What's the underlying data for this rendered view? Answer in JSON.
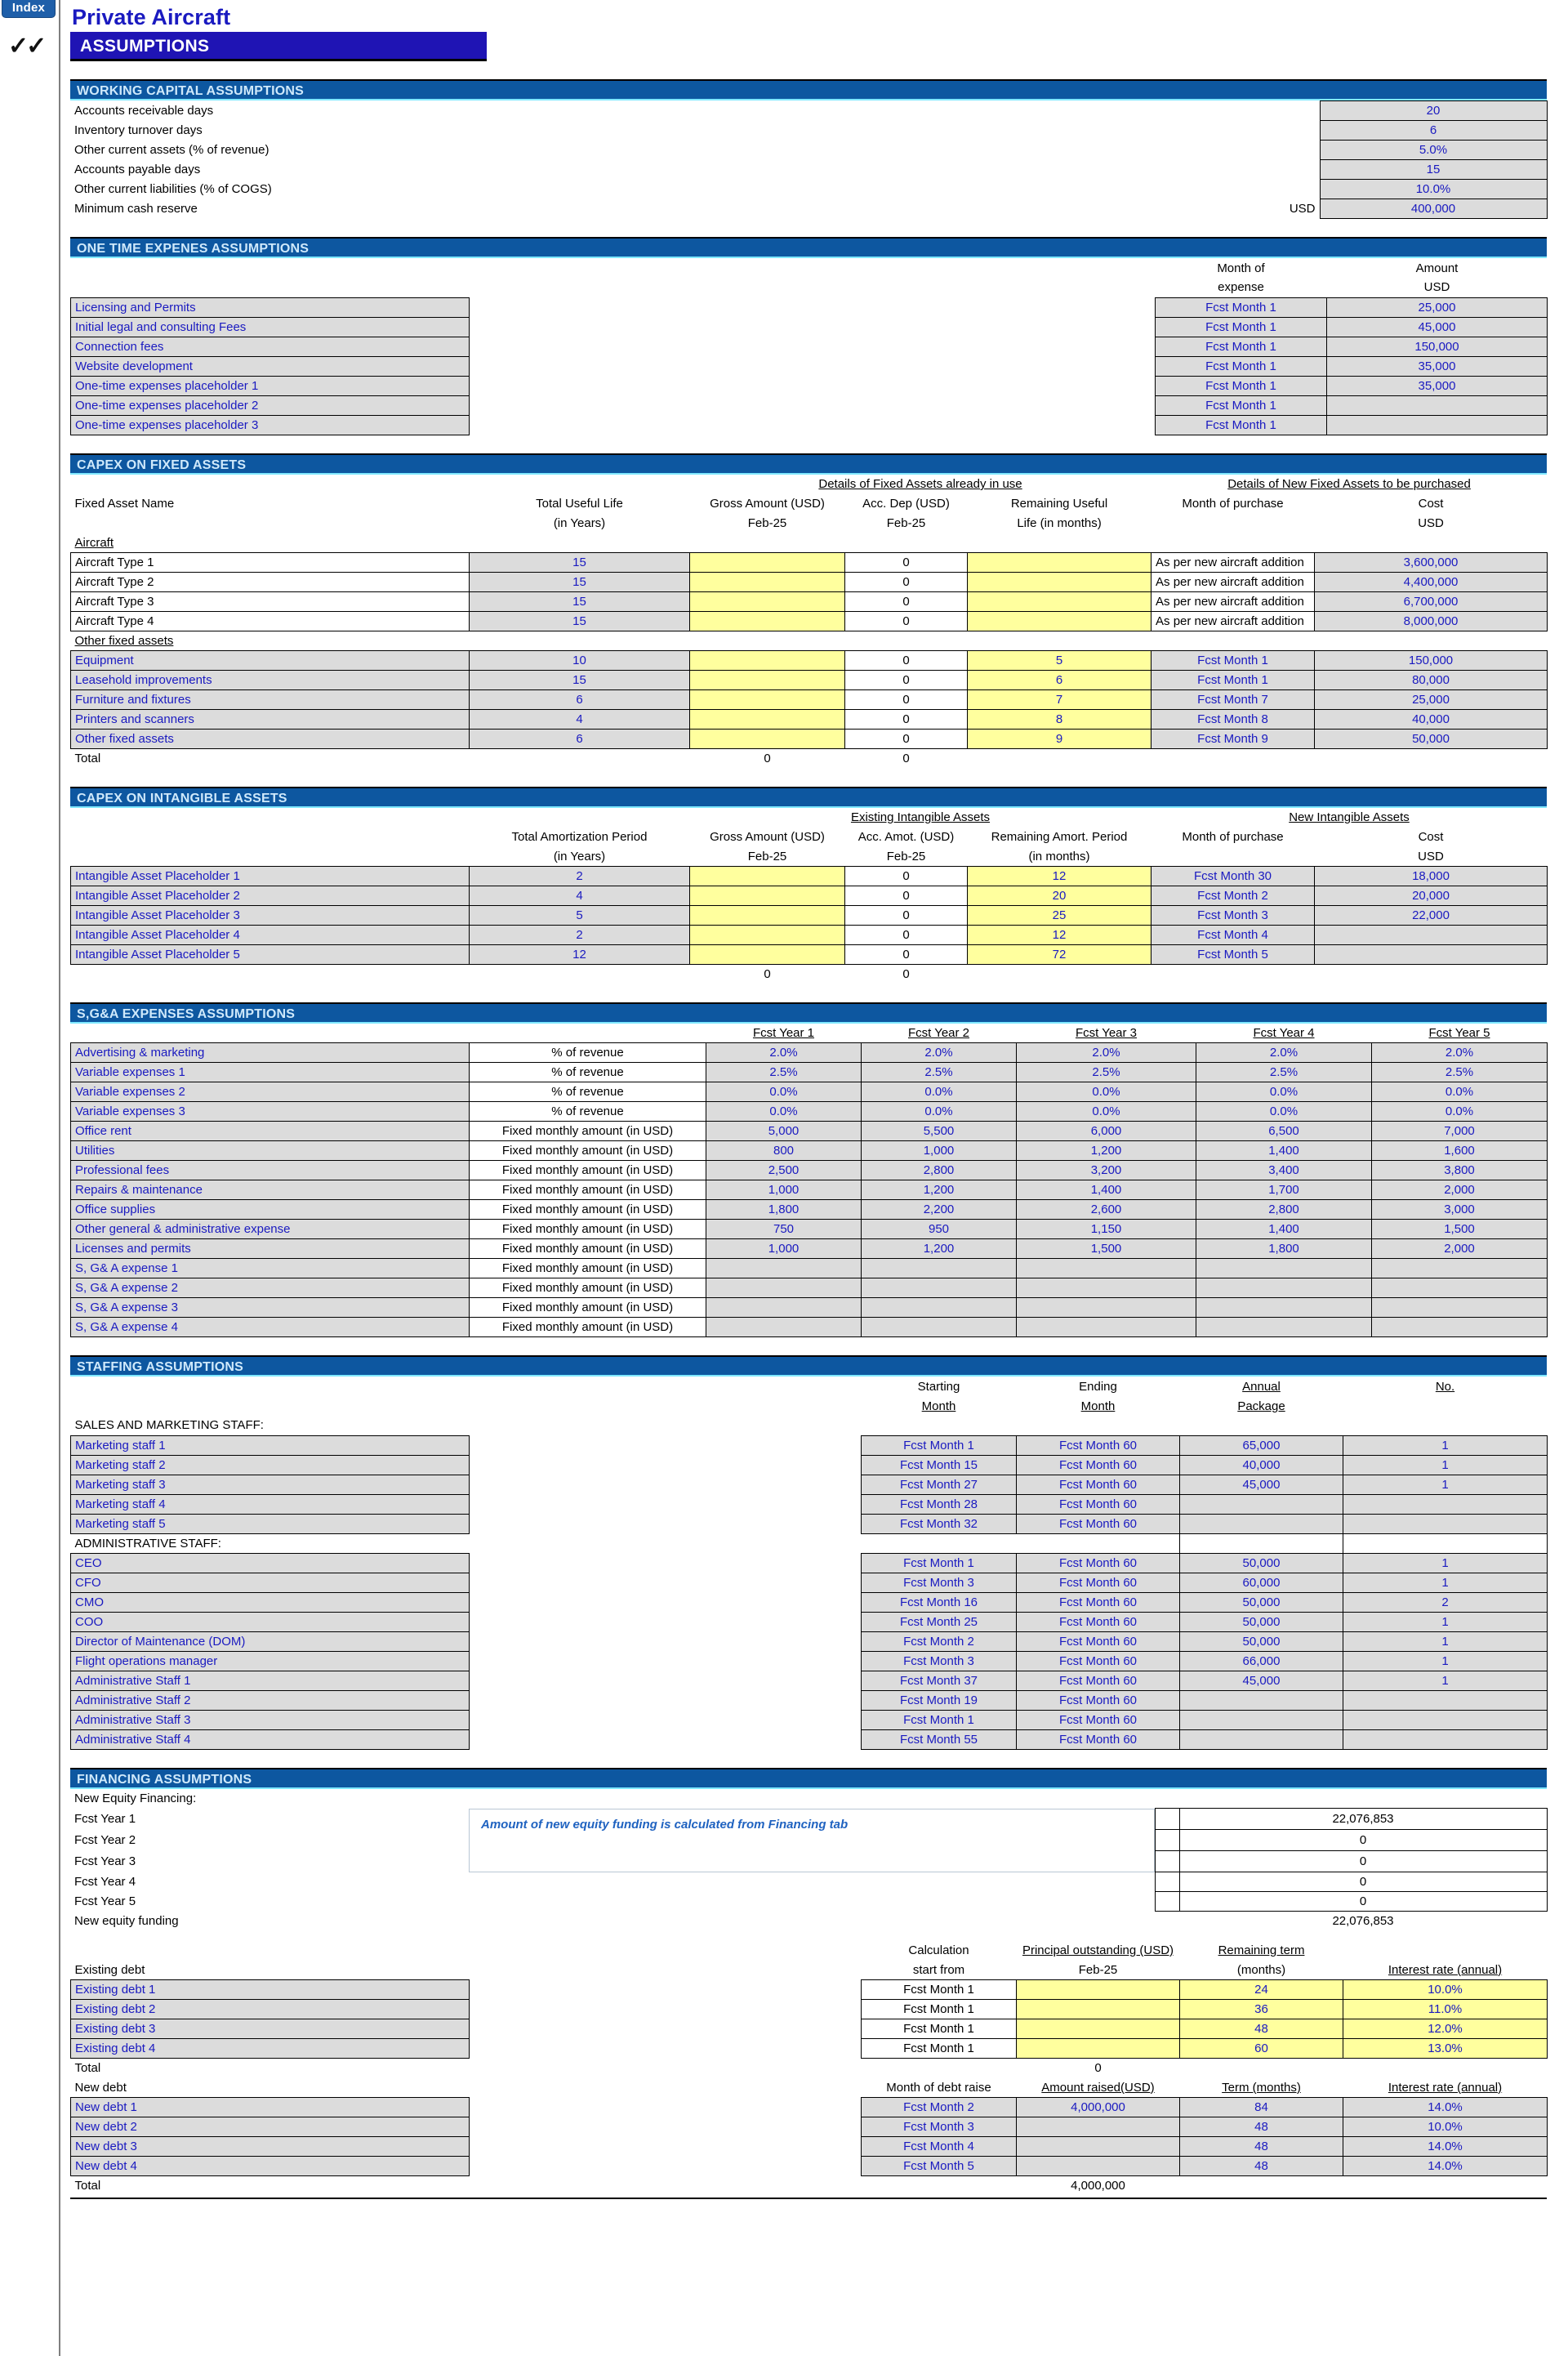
{
  "app": {
    "index_button": "Index",
    "checkmarks": "✓✓",
    "doc_title": "Private Aircraft",
    "page_title": "ASSUMPTIONS"
  },
  "working_capital": {
    "heading": "WORKING CAPITAL ASSUMPTIONS",
    "currency_label": "USD",
    "rows": [
      {
        "label": "Accounts receivable days",
        "value": "20"
      },
      {
        "label": "Inventory turnover days",
        "value": "6"
      },
      {
        "label": "Other current assets (% of revenue)",
        "value": "5.0%"
      },
      {
        "label": "Accounts payable days",
        "value": "15"
      },
      {
        "label": "Other current liabilities (% of COGS)",
        "value": "10.0%"
      },
      {
        "label": "Minimum cash reserve",
        "value": "400,000"
      }
    ]
  },
  "one_time_expenses": {
    "heading": "ONE TIME EXPENES ASSUMPTIONS",
    "col_month_1": "Month of",
    "col_month_2": "expense",
    "col_amount_1": "Amount",
    "col_amount_2": "USD",
    "rows": [
      {
        "label": "Licensing and Permits",
        "month": "Fcst Month 1",
        "amount": "25,000"
      },
      {
        "label": "Initial legal and consulting Fees",
        "month": "Fcst Month 1",
        "amount": "45,000"
      },
      {
        "label": "Connection fees",
        "month": "Fcst Month 1",
        "amount": "150,000"
      },
      {
        "label": "Website development",
        "month": "Fcst Month 1",
        "amount": "35,000"
      },
      {
        "label": "One-time expenses placeholder 1",
        "month": "Fcst Month 1",
        "amount": "35,000"
      },
      {
        "label": "One-time expenses placeholder 2",
        "month": "Fcst Month 1",
        "amount": ""
      },
      {
        "label": "One-time expenses placeholder 3",
        "month": "Fcst Month 1",
        "amount": ""
      }
    ]
  },
  "capex_fixed": {
    "heading": "CAPEX ON FIXED ASSETS",
    "group_existing": "Details of Fixed Assets already in use",
    "group_new": "Details of New Fixed Assets to be purchased",
    "col_name": "Fixed Asset Name",
    "col_life_1": "Total Useful Life",
    "col_life_2": "(in Years)",
    "col_gross_1": "Gross Amount (USD)",
    "col_gross_2": "Feb-25",
    "col_accdep_1": "Acc. Dep (USD)",
    "col_accdep_2": "Feb-25",
    "col_remaining_1": "Remaining Useful",
    "col_remaining_2": "Life (in months)",
    "col_month": "Month of purchase",
    "col_cost_1": "Cost",
    "col_cost_2": "USD",
    "group_aircraft": "Aircraft",
    "group_other": "Other fixed assets",
    "total_label": "Total",
    "total_gross": "0",
    "total_accdep": "0",
    "aircraft": [
      {
        "name": "Aircraft Type 1",
        "life": "15",
        "gross": "",
        "accdep": "0",
        "remaining": "",
        "month": "As per new aircraft addition",
        "cost": "3,600,000"
      },
      {
        "name": "Aircraft Type 2",
        "life": "15",
        "gross": "",
        "accdep": "0",
        "remaining": "",
        "month": "As per new aircraft addition",
        "cost": "4,400,000"
      },
      {
        "name": "Aircraft Type 3",
        "life": "15",
        "gross": "",
        "accdep": "0",
        "remaining": "",
        "month": "As per new aircraft addition",
        "cost": "6,700,000"
      },
      {
        "name": "Aircraft Type 4",
        "life": "15",
        "gross": "",
        "accdep": "0",
        "remaining": "",
        "month": "As per new aircraft addition",
        "cost": "8,000,000"
      }
    ],
    "other": [
      {
        "name": "Equipment",
        "life": "10",
        "gross": "",
        "accdep": "0",
        "remaining": "5",
        "month": "Fcst Month 1",
        "cost": "150,000"
      },
      {
        "name": "Leasehold improvements",
        "life": "15",
        "gross": "",
        "accdep": "0",
        "remaining": "6",
        "month": "Fcst Month 1",
        "cost": "80,000"
      },
      {
        "name": "Furniture and fixtures",
        "life": "6",
        "gross": "",
        "accdep": "0",
        "remaining": "7",
        "month": "Fcst Month 7",
        "cost": "25,000"
      },
      {
        "name": "Printers and scanners",
        "life": "4",
        "gross": "",
        "accdep": "0",
        "remaining": "8",
        "month": "Fcst Month 8",
        "cost": "40,000"
      },
      {
        "name": "Other fixed assets",
        "life": "6",
        "gross": "",
        "accdep": "0",
        "remaining": "9",
        "month": "Fcst Month 9",
        "cost": "50,000"
      }
    ]
  },
  "capex_intangible": {
    "heading": "CAPEX ON INTANGIBLE ASSETS",
    "group_existing": "Existing Intangible Assets",
    "group_new": "New Intangible Assets",
    "col_period_1": "Total Amortization Period",
    "col_period_2": "(in Years)",
    "col_gross_1": "Gross Amount (USD)",
    "col_gross_2": "Feb-25",
    "col_accamot_1": "Acc. Amot. (USD)",
    "col_accamot_2": "Feb-25",
    "col_remaining_1": "Remaining Amort. Period",
    "col_remaining_2": "(in months)",
    "col_month": "Month of purchase",
    "col_cost_1": "Cost",
    "col_cost_2": "USD",
    "total_gross": "0",
    "total_accamot": "0",
    "rows": [
      {
        "name": "Intangible Asset Placeholder 1",
        "period": "2",
        "gross": "",
        "accamot": "0",
        "remaining": "12",
        "month": "Fcst Month 30",
        "cost": "18,000"
      },
      {
        "name": "Intangible Asset Placeholder 2",
        "period": "4",
        "gross": "",
        "accamot": "0",
        "remaining": "20",
        "month": "Fcst Month 2",
        "cost": "20,000"
      },
      {
        "name": "Intangible Asset Placeholder 3",
        "period": "5",
        "gross": "",
        "accamot": "0",
        "remaining": "25",
        "month": "Fcst Month 3",
        "cost": "22,000"
      },
      {
        "name": "Intangible Asset Placeholder 4",
        "period": "2",
        "gross": "",
        "accamot": "0",
        "remaining": "12",
        "month": "Fcst Month 4",
        "cost": ""
      },
      {
        "name": "Intangible Asset Placeholder 5",
        "period": "12",
        "gross": "",
        "accamot": "0",
        "remaining": "72",
        "month": "Fcst Month 5",
        "cost": ""
      }
    ]
  },
  "sga": {
    "heading": "S,G&A EXPENSES ASSUMPTIONS",
    "year_headers": [
      "Fcst Year 1",
      "Fcst Year 2",
      "Fcst Year 3",
      "Fcst Year 4",
      "Fcst Year 5"
    ],
    "basis_pct": "% of revenue",
    "basis_fixed": "Fixed monthly amount (in USD)",
    "rows": [
      {
        "label": "Advertising & marketing",
        "basis": "% of revenue",
        "values": [
          "2.0%",
          "2.0%",
          "2.0%",
          "2.0%",
          "2.0%"
        ]
      },
      {
        "label": "Variable expenses 1",
        "basis": "% of revenue",
        "values": [
          "2.5%",
          "2.5%",
          "2.5%",
          "2.5%",
          "2.5%"
        ]
      },
      {
        "label": "Variable expenses 2",
        "basis": "% of revenue",
        "values": [
          "0.0%",
          "0.0%",
          "0.0%",
          "0.0%",
          "0.0%"
        ]
      },
      {
        "label": "Variable expenses 3",
        "basis": "% of revenue",
        "values": [
          "0.0%",
          "0.0%",
          "0.0%",
          "0.0%",
          "0.0%"
        ]
      },
      {
        "label": "Office rent",
        "basis": "Fixed monthly amount (in USD)",
        "values": [
          "5,000",
          "5,500",
          "6,000",
          "6,500",
          "7,000"
        ]
      },
      {
        "label": "Utilities",
        "basis": "Fixed monthly amount (in USD)",
        "values": [
          "800",
          "1,000",
          "1,200",
          "1,400",
          "1,600"
        ]
      },
      {
        "label": "Professional fees",
        "basis": "Fixed monthly amount (in USD)",
        "values": [
          "2,500",
          "2,800",
          "3,200",
          "3,400",
          "3,800"
        ]
      },
      {
        "label": "Repairs & maintenance",
        "basis": "Fixed monthly amount (in USD)",
        "values": [
          "1,000",
          "1,200",
          "1,400",
          "1,700",
          "2,000"
        ]
      },
      {
        "label": "Office supplies",
        "basis": "Fixed monthly amount (in USD)",
        "values": [
          "1,800",
          "2,200",
          "2,600",
          "2,800",
          "3,000"
        ]
      },
      {
        "label": "Other general & administrative expense",
        "basis": "Fixed monthly amount (in USD)",
        "values": [
          "750",
          "950",
          "1,150",
          "1,400",
          "1,500"
        ]
      },
      {
        "label": "Licenses and permits",
        "basis": "Fixed monthly amount (in USD)",
        "values": [
          "1,000",
          "1,200",
          "1,500",
          "1,800",
          "2,000"
        ]
      },
      {
        "label": "S, G& A expense 1",
        "basis": "Fixed monthly amount (in USD)",
        "values": [
          "",
          "",
          "",
          "",
          ""
        ]
      },
      {
        "label": "S, G& A expense 2",
        "basis": "Fixed monthly amount (in USD)",
        "values": [
          "",
          "",
          "",
          "",
          ""
        ]
      },
      {
        "label": "S, G& A expense 3",
        "basis": "Fixed monthly amount (in USD)",
        "values": [
          "",
          "",
          "",
          "",
          ""
        ]
      },
      {
        "label": "S, G& A expense 4",
        "basis": "Fixed monthly amount (in USD)",
        "values": [
          "",
          "",
          "",
          "",
          ""
        ]
      }
    ]
  },
  "staffing": {
    "heading": "STAFFING ASSUMPTIONS",
    "col_start_1": "Starting",
    "col_start_2": "Month",
    "col_end_1": "Ending",
    "col_end_2": "Month",
    "col_package_1": "Annual",
    "col_package_2": "Package",
    "col_no": "No.",
    "group_sales": "SALES AND MARKETING STAFF:",
    "group_admin": "ADMINISTRATIVE STAFF:",
    "sales": [
      {
        "name": "Marketing staff 1",
        "start": "Fcst Month 1",
        "end": "Fcst Month 60",
        "package": "65,000",
        "no": "1"
      },
      {
        "name": "Marketing staff 2",
        "start": "Fcst Month 15",
        "end": "Fcst Month 60",
        "package": "40,000",
        "no": "1"
      },
      {
        "name": "Marketing staff 3",
        "start": "Fcst Month 27",
        "end": "Fcst Month 60",
        "package": "45,000",
        "no": "1"
      },
      {
        "name": "Marketing staff 4",
        "start": "Fcst Month 28",
        "end": "Fcst Month 60",
        "package": "",
        "no": ""
      },
      {
        "name": "Marketing staff 5",
        "start": "Fcst Month 32",
        "end": "Fcst Month 60",
        "package": "",
        "no": ""
      }
    ],
    "admin": [
      {
        "name": "CEO",
        "start": "Fcst Month 1",
        "end": "Fcst Month 60",
        "package": "50,000",
        "no": "1"
      },
      {
        "name": "CFO",
        "start": "Fcst Month 3",
        "end": "Fcst Month 60",
        "package": "60,000",
        "no": "1"
      },
      {
        "name": "CMO",
        "start": "Fcst Month 16",
        "end": "Fcst Month 60",
        "package": "50,000",
        "no": "2"
      },
      {
        "name": "COO",
        "start": "Fcst Month 25",
        "end": "Fcst Month 60",
        "package": "50,000",
        "no": "1"
      },
      {
        "name": "Director of Maintenance (DOM)",
        "start": "Fcst Month 2",
        "end": "Fcst Month 60",
        "package": "50,000",
        "no": "1"
      },
      {
        "name": "Flight operations manager",
        "start": "Fcst Month 3",
        "end": "Fcst Month 60",
        "package": "66,000",
        "no": "1"
      },
      {
        "name": "Administrative Staff 1",
        "start": "Fcst Month 37",
        "end": "Fcst Month 60",
        "package": "45,000",
        "no": "1"
      },
      {
        "name": "Administrative Staff 2",
        "start": "Fcst Month 19",
        "end": "Fcst Month 60",
        "package": "",
        "no": ""
      },
      {
        "name": "Administrative Staff 3",
        "start": "Fcst Month 1",
        "end": "Fcst Month 60",
        "package": "",
        "no": ""
      },
      {
        "name": "Administrative Staff 4",
        "start": "Fcst Month 55",
        "end": "Fcst Month 60",
        "package": "",
        "no": ""
      }
    ]
  },
  "financing": {
    "heading": "FINANCING ASSUMPTIONS",
    "equity_title": "New Equity Financing:",
    "equity_note": "Amount of new equity funding is calculated from Financing  tab",
    "equity_rows": [
      {
        "label": "Fcst Year 1",
        "value": "22,076,853"
      },
      {
        "label": "Fcst Year 2",
        "value": "0"
      },
      {
        "label": "Fcst Year 3",
        "value": "0"
      },
      {
        "label": "Fcst Year 4",
        "value": "0"
      },
      {
        "label": "Fcst Year 5",
        "value": "0"
      }
    ],
    "equity_total_label": "New equity funding",
    "equity_total_value": "22,076,853",
    "existing_debt_title": "Existing debt",
    "col_calc_1": "Calculation",
    "col_calc_2": "start from",
    "col_principal_1": "Principal outstanding (USD)",
    "col_principal_2": "Feb-25",
    "col_term_1": "Remaining term",
    "col_term_2": "(months)",
    "col_rate": "Interest rate (annual)",
    "existing_debt": [
      {
        "name": "Existing debt 1",
        "start": "Fcst Month 1",
        "principal": "",
        "term": "24",
        "rate": "10.0%"
      },
      {
        "name": "Existing debt 2",
        "start": "Fcst Month 1",
        "principal": "",
        "term": "36",
        "rate": "11.0%"
      },
      {
        "name": "Existing debt 3",
        "start": "Fcst Month 1",
        "principal": "",
        "term": "48",
        "rate": "12.0%"
      },
      {
        "name": "Existing debt 4",
        "start": "Fcst Month 1",
        "principal": "",
        "term": "60",
        "rate": "13.0%"
      }
    ],
    "existing_total_label": "Total",
    "existing_total_value": "0",
    "new_debt_title": "New debt",
    "col_newmonth": "Month of debt raise",
    "col_amount": "Amount raised(USD)",
    "col_newterm": "Term (months)",
    "col_newrate": "Interest rate (annual)",
    "new_debt": [
      {
        "name": "New debt 1",
        "month": "Fcst Month 2",
        "amount": "4,000,000",
        "term": "84",
        "rate": "14.0%"
      },
      {
        "name": "New debt 2",
        "month": "Fcst Month 3",
        "amount": "",
        "term": "48",
        "rate": "10.0%"
      },
      {
        "name": "New debt 3",
        "month": "Fcst Month 4",
        "amount": "",
        "term": "48",
        "rate": "14.0%"
      },
      {
        "name": "New debt 4",
        "month": "Fcst Month 5",
        "amount": "",
        "term": "48",
        "rate": "14.0%"
      }
    ],
    "new_total_label": "Total",
    "new_total_value": "4,000,000"
  }
}
